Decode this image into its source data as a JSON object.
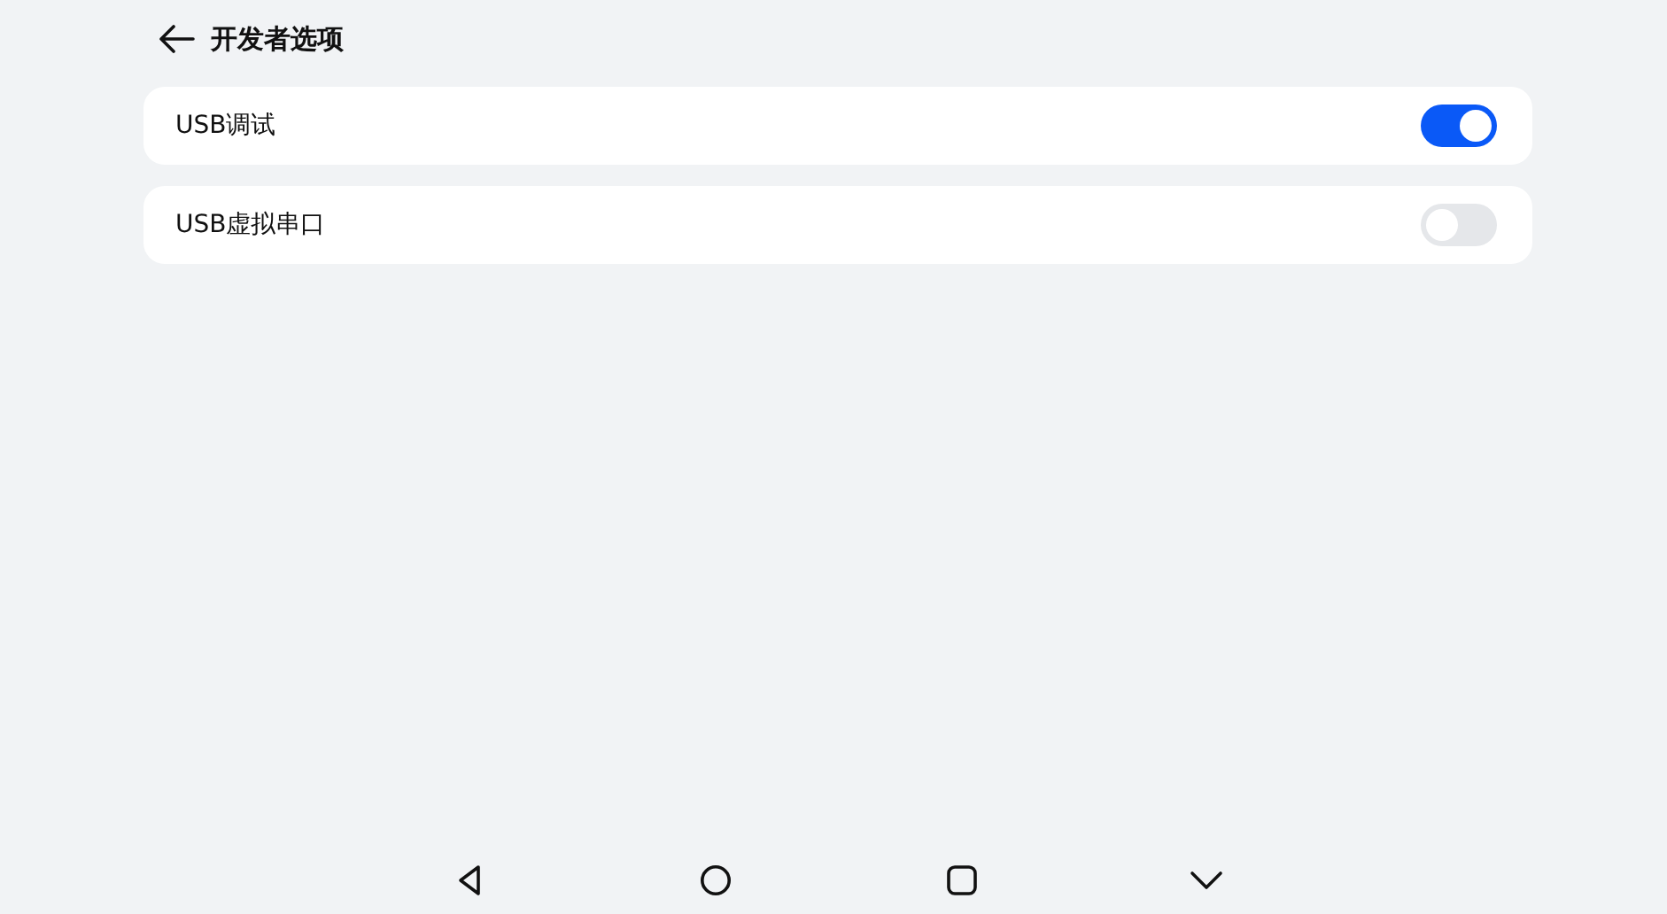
{
  "header": {
    "title": "开发者选项"
  },
  "settings": [
    {
      "label": "USB调试",
      "on": true
    },
    {
      "label": "USB虚拟串口",
      "on": false
    }
  ]
}
